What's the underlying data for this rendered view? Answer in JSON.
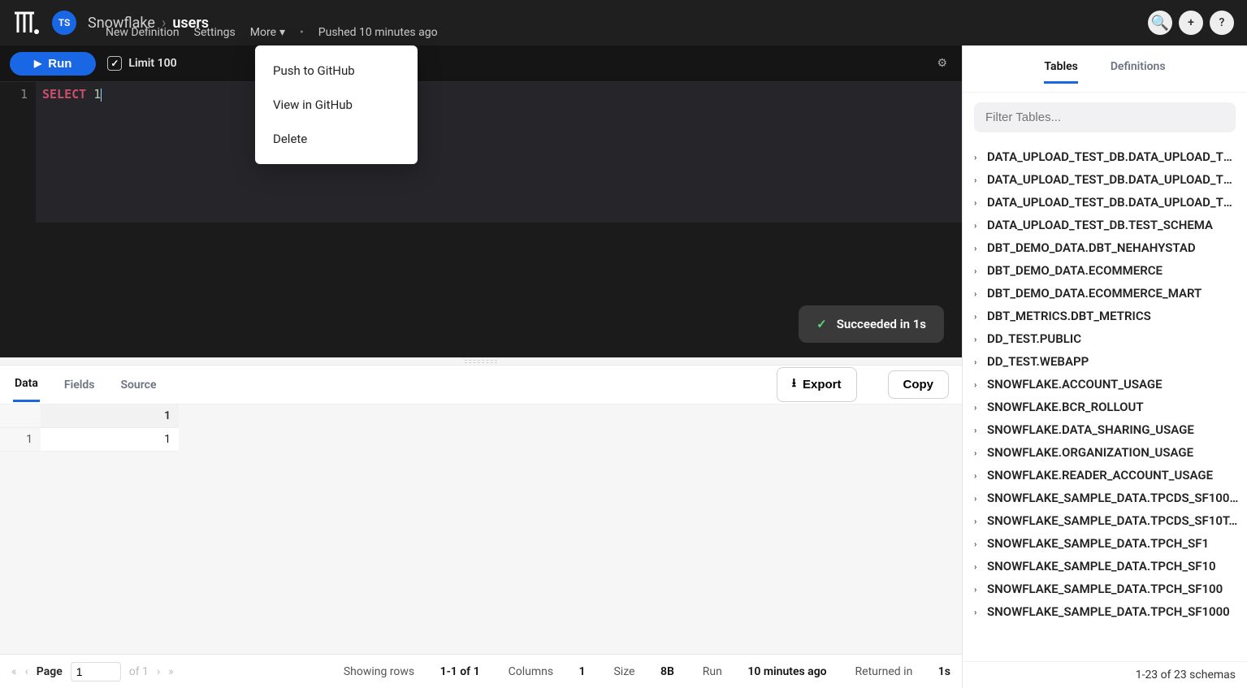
{
  "header": {
    "avatar_initials": "TS",
    "workspace": "Snowflake",
    "breadcrumb_sep": "›",
    "name": "users",
    "subnav": {
      "new_definition": "New Definition",
      "settings": "Settings",
      "more": "More",
      "pushed": "Pushed 10 minutes ago"
    },
    "icons": {
      "search": "⌕",
      "plus": "+",
      "help": "?"
    }
  },
  "toolbar": {
    "run": "Run",
    "limit_label": "Limit 100"
  },
  "editor": {
    "line_no": "1",
    "keyword": "SELECT",
    "value": "1"
  },
  "dropdown": {
    "push": "Push to GitHub",
    "view": "View in GitHub",
    "delete": "Delete"
  },
  "toast": {
    "text": "Succeeded in 1s"
  },
  "results": {
    "tabs": {
      "data": "Data",
      "fields": "Fields",
      "source": "Source"
    },
    "export": "Export",
    "copy": "Copy",
    "header_col": "1",
    "rows": [
      {
        "rownum": "1",
        "v": "1"
      }
    ]
  },
  "footer": {
    "page_label": "Page",
    "page_value": "1",
    "of_label": "of 1",
    "showing_label": "Showing rows",
    "showing_value": "1-1 of 1",
    "columns_label": "Columns",
    "columns_value": "1",
    "size_label": "Size",
    "size_value": "8B",
    "run_label": "Run",
    "run_value": "10 minutes ago",
    "returned_label": "Returned in",
    "returned_value": "1s"
  },
  "right": {
    "tabs": {
      "tables": "Tables",
      "definitions": "Definitions"
    },
    "filter_placeholder": "Filter Tables...",
    "schemas": [
      "DATA_UPLOAD_TEST_DB.DATA_UPLOAD_TE...",
      "DATA_UPLOAD_TEST_DB.DATA_UPLOAD_TE...",
      "DATA_UPLOAD_TEST_DB.DATA_UPLOAD_TE...",
      "DATA_UPLOAD_TEST_DB.TEST_SCHEMA",
      "DBT_DEMO_DATA.DBT_NEHAHYSTAD",
      "DBT_DEMO_DATA.ECOMMERCE",
      "DBT_DEMO_DATA.ECOMMERCE_MART",
      "DBT_METRICS.DBT_METRICS",
      "DD_TEST.PUBLIC",
      "DD_TEST.WEBAPP",
      "SNOWFLAKE.ACCOUNT_USAGE",
      "SNOWFLAKE.BCR_ROLLOUT",
      "SNOWFLAKE.DATA_SHARING_USAGE",
      "SNOWFLAKE.ORGANIZATION_USAGE",
      "SNOWFLAKE.READER_ACCOUNT_USAGE",
      "SNOWFLAKE_SAMPLE_DATA.TPCDS_SF100...",
      "SNOWFLAKE_SAMPLE_DATA.TPCDS_SF10T...",
      "SNOWFLAKE_SAMPLE_DATA.TPCH_SF1",
      "SNOWFLAKE_SAMPLE_DATA.TPCH_SF10",
      "SNOWFLAKE_SAMPLE_DATA.TPCH_SF100",
      "SNOWFLAKE_SAMPLE_DATA.TPCH_SF1000"
    ],
    "footer": "1-23 of 23 schemas"
  }
}
